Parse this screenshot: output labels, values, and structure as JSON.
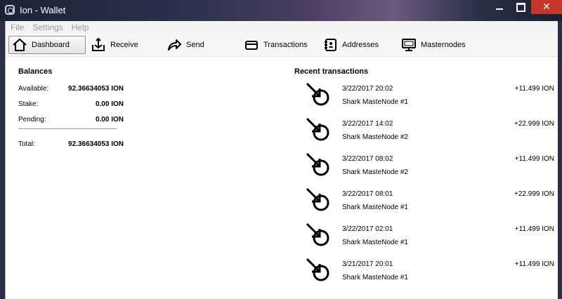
{
  "window": {
    "title": "Ion - Wallet"
  },
  "menu": [
    "File",
    "Settings",
    "Help"
  ],
  "toolbar": {
    "dashboard": "Dashboard",
    "receive": "Receive",
    "send": "Send",
    "transactions": "Transactions",
    "addresses": "Addresses",
    "masternodes": "Masternodes"
  },
  "balances": {
    "title": "Balances",
    "available_label": "Available:",
    "available_value": "92.36634053 ION",
    "stake_label": "Stake:",
    "stake_value": "0.00 ION",
    "pending_label": "Pending:",
    "pending_value": "0.00 ION",
    "total_label": "Total:",
    "total_value": "92.36634053 ION"
  },
  "recent": {
    "title": "Recent transactions",
    "items": [
      {
        "date": "3/22/2017 20:02",
        "label": "Shark MasteNode #1",
        "amount": "+11.499 ION"
      },
      {
        "date": "3/22/2017 14:02",
        "label": "Shark MasteNode #2",
        "amount": "+22.999 ION"
      },
      {
        "date": "3/22/2017 08:02",
        "label": "Shark MasteNode #2",
        "amount": "+11.499 ION"
      },
      {
        "date": "3/22/2017 08:01",
        "label": "Shark MasteNode #1",
        "amount": "+22.999 ION"
      },
      {
        "date": "3/22/2017 02:01",
        "label": "Shark MasteNode #1",
        "amount": "+11.499 ION"
      },
      {
        "date": "3/21/2017 20:01",
        "label": "Shark MasteNode #1",
        "amount": "+11.499 ION"
      }
    ]
  },
  "icons": {
    "app": "ion-logo-icon",
    "dashboard": "home-icon",
    "receive": "receive-inbox-icon",
    "send": "send-arrow-icon",
    "transactions": "card-icon",
    "addresses": "address-book-icon",
    "masternodes": "monitor-icon",
    "tx": "incoming-transaction-icon"
  }
}
